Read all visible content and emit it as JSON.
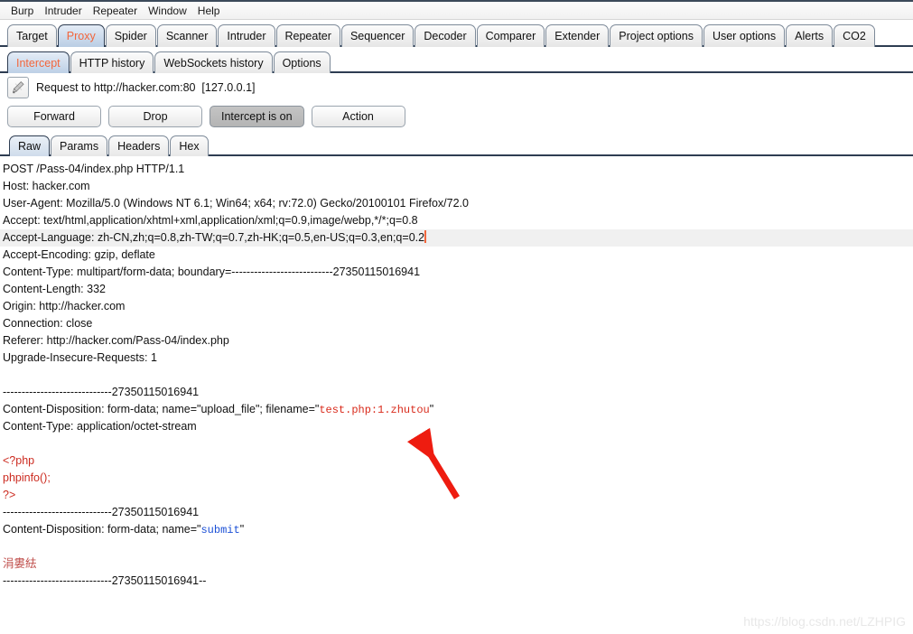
{
  "menubar": {
    "items": [
      {
        "label": "Burp"
      },
      {
        "label": "Intruder"
      },
      {
        "label": "Repeater"
      },
      {
        "label": "Window"
      },
      {
        "label": "Help"
      }
    ]
  },
  "main_tabs": [
    {
      "label": "Target",
      "active": false
    },
    {
      "label": "Proxy",
      "active": true
    },
    {
      "label": "Spider",
      "active": false
    },
    {
      "label": "Scanner",
      "active": false
    },
    {
      "label": "Intruder",
      "active": false
    },
    {
      "label": "Repeater",
      "active": false
    },
    {
      "label": "Sequencer",
      "active": false
    },
    {
      "label": "Decoder",
      "active": false
    },
    {
      "label": "Comparer",
      "active": false
    },
    {
      "label": "Extender",
      "active": false
    },
    {
      "label": "Project options",
      "active": false
    },
    {
      "label": "User options",
      "active": false
    },
    {
      "label": "Alerts",
      "active": false
    },
    {
      "label": "CO2",
      "active": false
    }
  ],
  "sub_tabs": [
    {
      "label": "Intercept",
      "active": true
    },
    {
      "label": "HTTP history",
      "active": false
    },
    {
      "label": "WebSockets history",
      "active": false
    },
    {
      "label": "Options",
      "active": false
    }
  ],
  "target": {
    "icon": "pencil-icon",
    "text": "Request to http://hacker.com:80  [127.0.0.1]"
  },
  "buttons": [
    {
      "label": "Forward",
      "pressed": false
    },
    {
      "label": "Drop",
      "pressed": false
    },
    {
      "label": "Intercept is on",
      "pressed": true
    },
    {
      "label": "Action",
      "pressed": false
    }
  ],
  "editor_tabs": [
    {
      "label": "Raw",
      "active": true
    },
    {
      "label": "Params",
      "active": false
    },
    {
      "label": "Headers",
      "active": false
    },
    {
      "label": "Hex",
      "active": false
    }
  ],
  "request": {
    "lines": [
      {
        "text": "POST /Pass-04/index.php HTTP/1.1"
      },
      {
        "text": "Host: hacker.com"
      },
      {
        "text": "User-Agent: Mozilla/5.0 (Windows NT 6.1; Win64; x64; rv:72.0) Gecko/20100101 Firefox/72.0"
      },
      {
        "text": "Accept: text/html,application/xhtml+xml,application/xml;q=0.9,image/webp,*/*;q=0.8"
      },
      {
        "text": "Accept-Language: zh-CN,zh;q=0.8,zh-TW;q=0.7,zh-HK;q=0.5,en-US;q=0.3,en;q=0.2",
        "highlight": true,
        "caret": true
      },
      {
        "text": "Accept-Encoding: gzip, deflate"
      },
      {
        "text": "Content-Type: multipart/form-data; boundary=---------------------------27350115016941"
      },
      {
        "text": "Content-Length: 332"
      },
      {
        "text": "Origin: http://hacker.com"
      },
      {
        "text": "Connection: close"
      },
      {
        "text": "Referer: http://hacker.com/Pass-04/index.php"
      },
      {
        "text": "Upgrade-Insecure-Requests: 1"
      },
      {
        "text": ""
      },
      {
        "text": "-----------------------------27350115016941"
      },
      {
        "prefix": "Content-Disposition: form-data; name=\"upload_file\"; filename=\"",
        "accent": "test.php:1.zhutou",
        "accent_color": "red",
        "suffix": "\""
      },
      {
        "text": "Content-Type: application/octet-stream"
      },
      {
        "text": ""
      },
      {
        "text": "<?php",
        "style": "redtext"
      },
      {
        "text": "phpinfo();",
        "style": "redtext"
      },
      {
        "text": "?>",
        "style": "redtext"
      },
      {
        "text": "-----------------------------27350115016941"
      },
      {
        "prefix": "Content-Disposition: form-data; name=\"",
        "accent": "submit",
        "accent_color": "blue",
        "suffix": "\""
      },
      {
        "text": ""
      },
      {
        "text": "涓婁紶",
        "style": "cjk"
      },
      {
        "text": "-----------------------------27350115016941--"
      }
    ]
  },
  "annotation": {
    "arrow_color": "#ee1c10",
    "points_to": "test.php:1.zhutou"
  },
  "watermark": {
    "text": "https://blog.csdn.net/LZHPIG"
  }
}
